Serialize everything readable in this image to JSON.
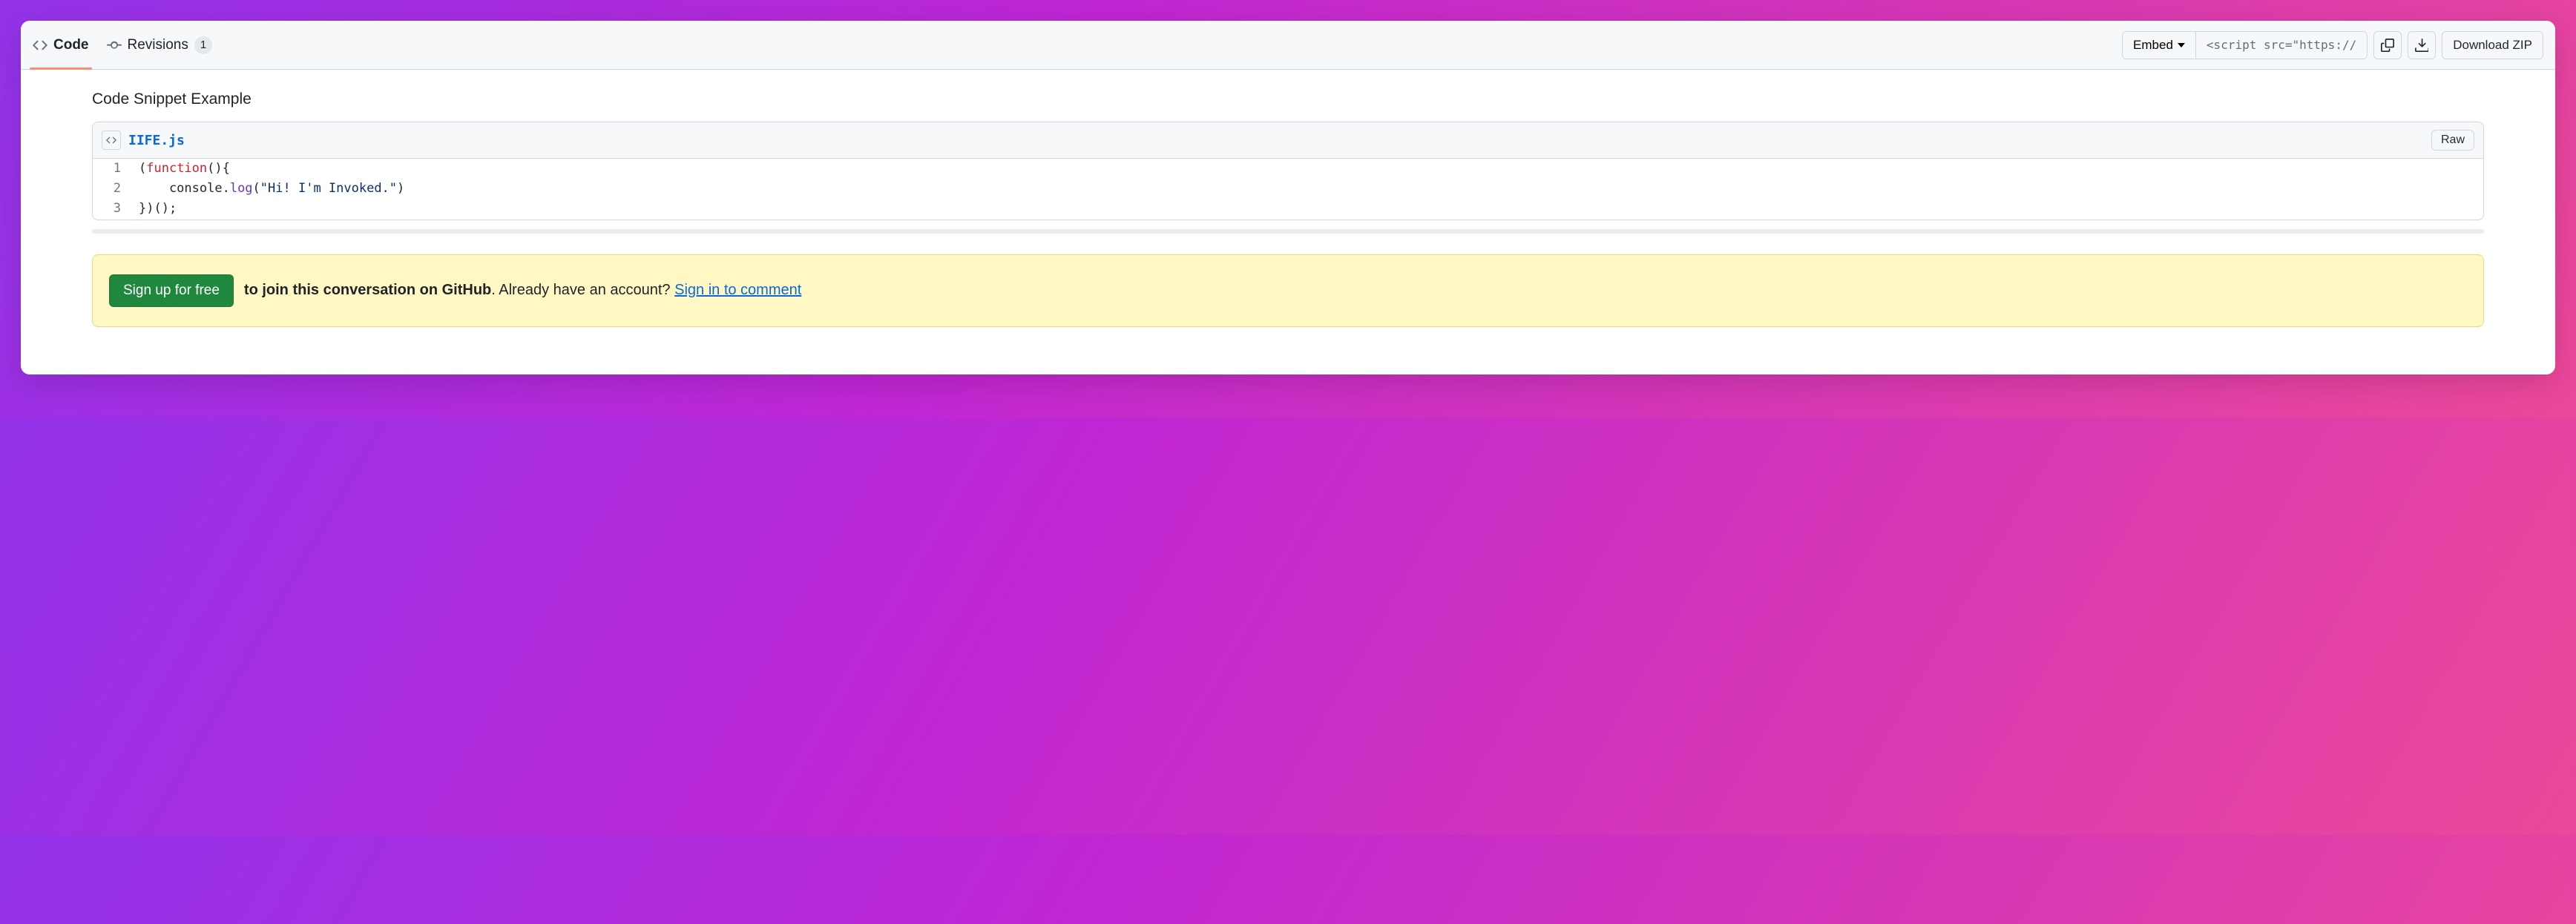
{
  "tabs": {
    "code": {
      "label": "Code"
    },
    "revisions": {
      "label": "Revisions",
      "count": "1"
    }
  },
  "toolbar": {
    "embed_label": "Embed",
    "embed_script": "<script src=\"https://",
    "download_label": "Download ZIP"
  },
  "gist": {
    "description": "Code Snippet Example",
    "filename": "IIFE.js",
    "raw_label": "Raw",
    "lines": [
      {
        "n": "1",
        "pre": "(",
        "kw": "function",
        "post": "(){"
      },
      {
        "n": "2",
        "pre": "    console.",
        "fn": "log",
        "mid": "(",
        "str": "\"Hi! I'm Invoked.\"",
        "post": ")"
      },
      {
        "n": "3",
        "pre": "})();"
      }
    ]
  },
  "banner": {
    "signup": "Sign up for free",
    "bold": "to join this conversation on GitHub",
    "plain": ". Already have an account? ",
    "signin": "Sign in to comment"
  }
}
